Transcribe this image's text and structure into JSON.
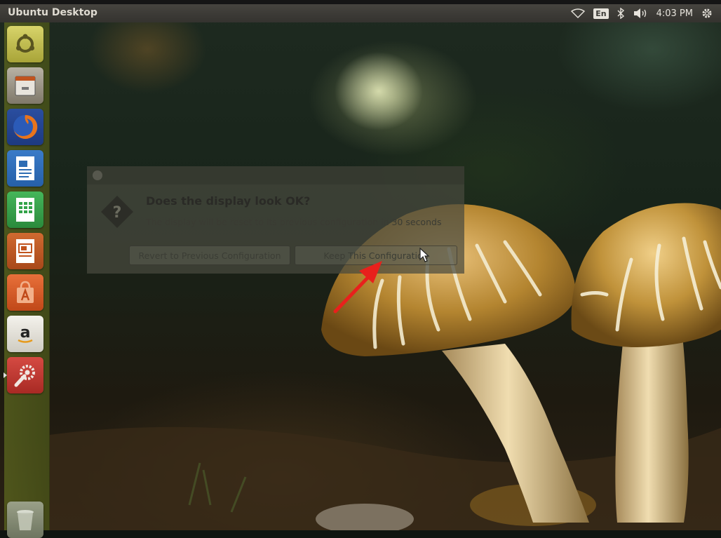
{
  "top_panel": {
    "title": "Ubuntu Desktop",
    "language": "En",
    "time": "4:03 PM",
    "icons": [
      "wifi-icon",
      "bluetooth-icon",
      "volume-icon",
      "system-gear-icon"
    ]
  },
  "launcher": {
    "items": [
      {
        "name": "ubuntu-dash",
        "icon": "ubuntu-logo-icon",
        "color": "#c8c45a"
      },
      {
        "name": "files",
        "icon": "file-cabinet-icon",
        "color": "#8d8677"
      },
      {
        "name": "firefox",
        "icon": "firefox-icon",
        "color": "#d0621d"
      },
      {
        "name": "libreoffice-writer",
        "icon": "writer-document-icon",
        "color": "#2e6db4"
      },
      {
        "name": "libreoffice-calc",
        "icon": "calc-spreadsheet-icon",
        "color": "#33a349"
      },
      {
        "name": "libreoffice-impress",
        "icon": "impress-presentation-icon",
        "color": "#c1541e"
      },
      {
        "name": "ubuntu-software-center",
        "icon": "shopping-bag-icon",
        "color": "#d95621"
      },
      {
        "name": "amazon",
        "icon": "amazon-icon",
        "color": "#e9e7e1"
      },
      {
        "name": "system-settings",
        "icon": "settings-wrench-icon",
        "color": "#c33a34"
      },
      {
        "name": "trash",
        "icon": "trash-icon",
        "color": "#8e9580"
      }
    ]
  },
  "dialog": {
    "heading": "Does the display look OK?",
    "message": "The display will be reset to its previous configuration in 30 seconds",
    "revert_label": "Revert to Previous Configuration",
    "keep_label": "Keep This Configuration"
  },
  "annotation": {
    "arrow_color": "#e8201c"
  }
}
